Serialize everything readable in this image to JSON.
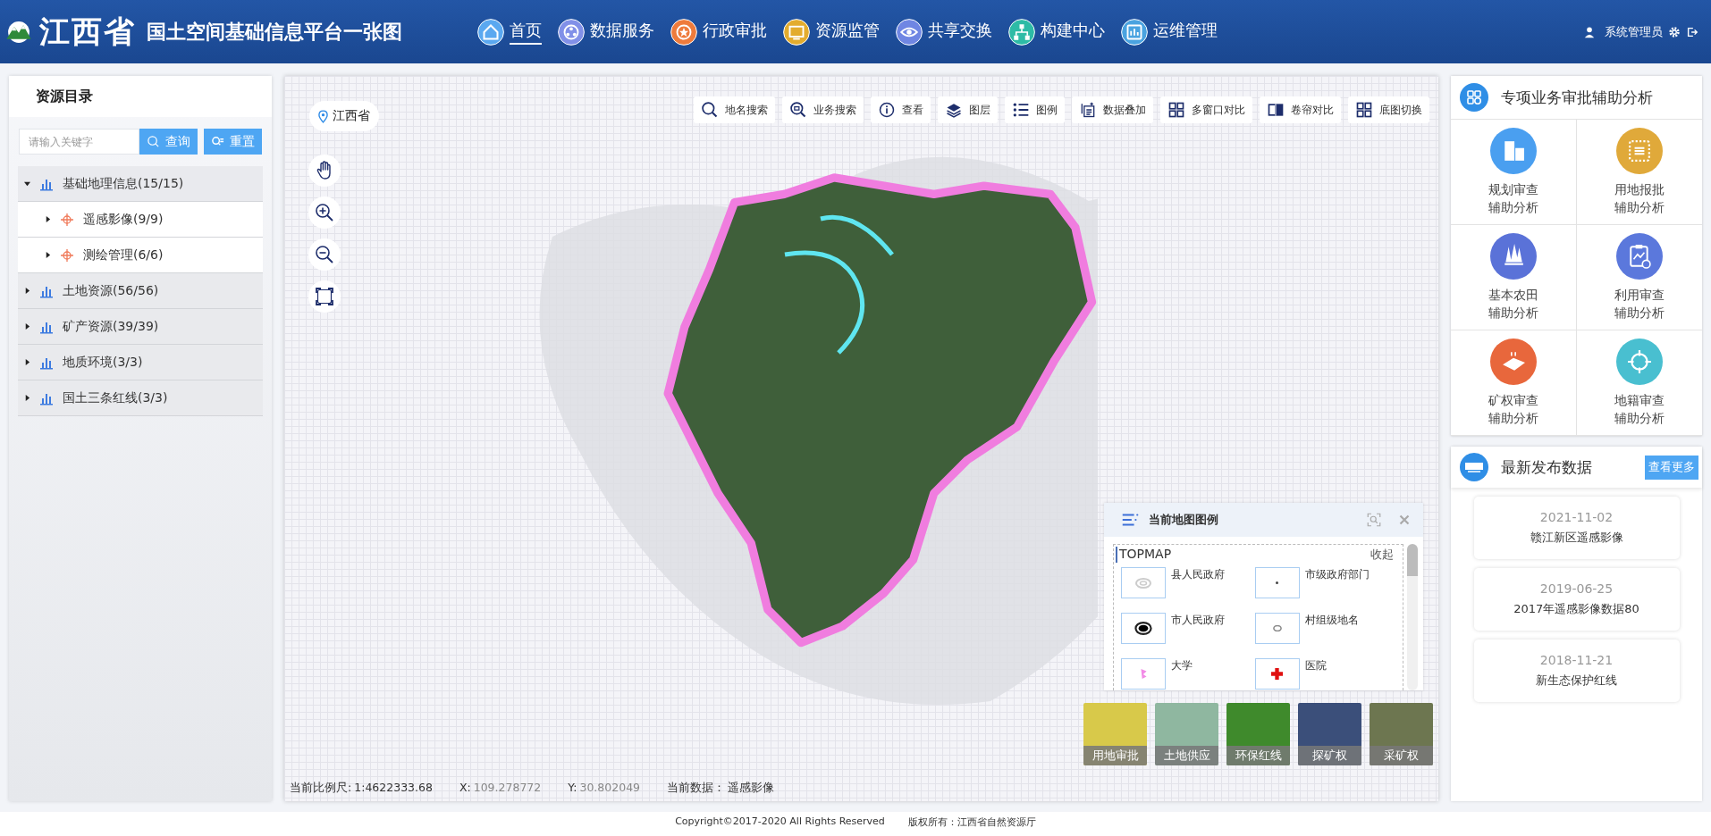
{
  "header": {
    "logo_text": "江西省",
    "title": "国土空间基础信息平台一张图",
    "user": "系统管理员"
  },
  "nav": [
    {
      "label": "首页",
      "kind": "home",
      "selected": true
    },
    {
      "label": "数据服务",
      "kind": "data",
      "selected": false
    },
    {
      "label": "行政审批",
      "kind": "approve",
      "selected": false
    },
    {
      "label": "资源监管",
      "kind": "monitor",
      "selected": false
    },
    {
      "label": "共享交换",
      "kind": "share",
      "selected": false
    },
    {
      "label": "构建中心",
      "kind": "build",
      "selected": false
    },
    {
      "label": "运维管理",
      "kind": "ops",
      "selected": false
    }
  ],
  "sidebar": {
    "title": "资源目录",
    "search": {
      "placeholder": "请输入关键字"
    },
    "buttons": [
      {
        "label": "查询",
        "kind": "search"
      },
      {
        "label": "重置",
        "kind": "reset"
      }
    ],
    "tree": [
      {
        "label": "基础地理信息(15/15)",
        "expanded": true,
        "children": [
          {
            "label": "遥感影像(9/9)",
            "expanded": false
          },
          {
            "label": "测绘管理(6/6)",
            "expanded": false
          }
        ]
      },
      {
        "label": "土地资源(56/56)",
        "expanded": false
      },
      {
        "label": "矿产资源(39/39)",
        "expanded": false
      },
      {
        "label": "地质环境(3/3)",
        "expanded": false
      },
      {
        "label": "国土三条红线(3/3)",
        "expanded": false
      }
    ]
  },
  "map": {
    "location": "江西省",
    "toolbar": [
      {
        "label": "地名搜索",
        "kind": "place"
      },
      {
        "label": "业务搜索",
        "kind": "business"
      },
      {
        "label": "查看",
        "kind": "info"
      },
      {
        "label": "图层",
        "kind": "layers"
      },
      {
        "label": "图例",
        "kind": "legend"
      },
      {
        "label": "数据叠加",
        "kind": "overlay"
      },
      {
        "label": "多窗口对比",
        "kind": "grid"
      },
      {
        "label": "卷帘对比",
        "kind": "swipe"
      },
      {
        "label": "底图切换",
        "kind": "grid"
      }
    ],
    "tools": [
      {
        "kind": "pan"
      },
      {
        "kind": "zoom-in"
      },
      {
        "kind": "zoom-out"
      },
      {
        "kind": "fullscreen"
      }
    ],
    "legend": {
      "title": "当前地图图例",
      "group": "TOPMAP",
      "collapse": "收起",
      "items": [
        {
          "label": "县人民政府",
          "kind": "ring-light"
        },
        {
          "label": "市级政府部门",
          "kind": "dot"
        },
        {
          "label": "市人民政府",
          "kind": "ring-dark"
        },
        {
          "label": "村组级地名",
          "kind": "ring-small"
        },
        {
          "label": "大学",
          "kind": "university"
        },
        {
          "label": "医院",
          "kind": "hospital"
        }
      ]
    },
    "thumbnails": [
      {
        "label": "用地审批",
        "color": "#d8c94a"
      },
      {
        "label": "土地供应",
        "color": "#8fb7a0"
      },
      {
        "label": "环保红线",
        "color": "#3f8a2c"
      },
      {
        "label": "探矿权",
        "color": "#3b4f7a"
      },
      {
        "label": "采矿权",
        "color": "#6d7650"
      }
    ],
    "status": [
      {
        "label": "当前比例尺:",
        "value": "1:4622333.68"
      },
      {
        "label": "X:",
        "value": "109.278772"
      },
      {
        "label": "Y:",
        "value": "30.802049"
      },
      {
        "label": "当前数据：",
        "value": "遥感影像"
      }
    ]
  },
  "analysis": {
    "title": "专项业务审批辅助分析",
    "items": [
      {
        "lines": [
          "规划审查",
          "辅助分析"
        ],
        "kind": "building",
        "color": "#4a9ff0"
      },
      {
        "lines": [
          "用地报批",
          "辅助分析"
        ],
        "kind": "document",
        "color": "#e0a93a"
      },
      {
        "lines": [
          "基本农田",
          "辅助分析"
        ],
        "kind": "trees",
        "color": "#5a72d8"
      },
      {
        "lines": [
          "利用审查",
          "辅助分析"
        ],
        "kind": "clipboard",
        "color": "#5b78dc"
      },
      {
        "lines": [
          "矿权审查",
          "辅助分析"
        ],
        "kind": "mine",
        "color": "#e8673c"
      },
      {
        "lines": [
          "地籍审查",
          "辅助分析"
        ],
        "kind": "target",
        "color": "#49bfd0"
      }
    ]
  },
  "news": {
    "title": "最新发布数据",
    "more": "查看更多",
    "items": [
      {
        "date": "2021-11-02",
        "title": "赣江新区遥感影像"
      },
      {
        "date": "2019-06-25",
        "title": "2017年遥感影像数据80"
      },
      {
        "date": "2018-11-21",
        "title": "新生态保护红线"
      }
    ]
  },
  "footer": {
    "copyright": "Copyright©2017-2020 All Rights Reserved",
    "owner": "版权所有：江西省自然资源厅"
  }
}
